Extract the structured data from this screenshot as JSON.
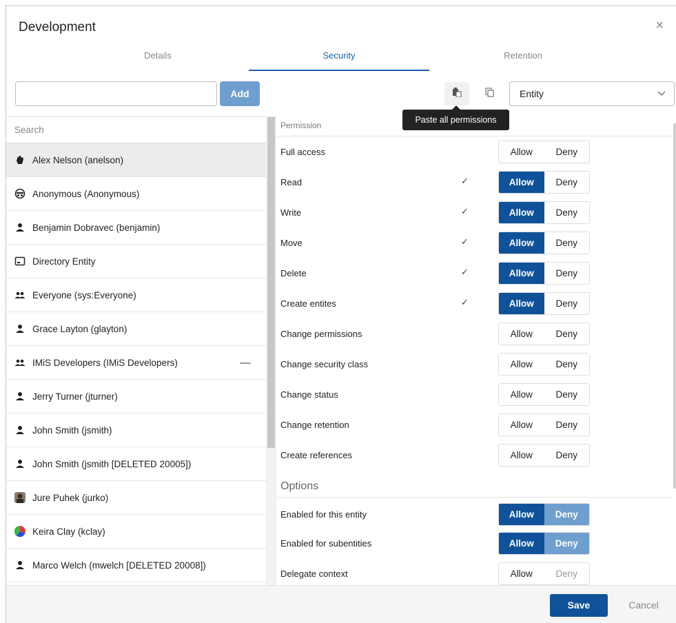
{
  "dialog": {
    "title": "Development",
    "close_icon": "×"
  },
  "tabs": [
    {
      "label": "Details",
      "active": false
    },
    {
      "label": "Security",
      "active": true
    },
    {
      "label": "Retention",
      "active": false
    }
  ],
  "toolbar": {
    "input_value": "",
    "add_label": "Add",
    "paste_tooltip": "Paste all permissions",
    "entity_select_value": "Entity"
  },
  "users": {
    "search_placeholder": "Search",
    "items": [
      {
        "label": "Alex Nelson (anelson)",
        "icon": "hand-icon",
        "selected": true
      },
      {
        "label": "Anonymous (Anonymous)",
        "icon": "anonymous-icon"
      },
      {
        "label": "Benjamin Dobravec (benjamin)",
        "icon": "person-icon"
      },
      {
        "label": "Directory Entity",
        "icon": "directory-icon"
      },
      {
        "label": "Everyone (sys:Everyone)",
        "icon": "group-icon"
      },
      {
        "label": "Grace Layton (glayton)",
        "icon": "person-icon"
      },
      {
        "label": "IMiS Developers (IMiS Developers)",
        "icon": "group-icon",
        "removable": true
      },
      {
        "label": "Jerry Turner (jturner)",
        "icon": "person-icon"
      },
      {
        "label": "John Smith (jsmith)",
        "icon": "person-icon"
      },
      {
        "label": "John Smith (jsmith [DELETED 20005])",
        "icon": "person-icon"
      },
      {
        "label": "Jure Puhek (jurko)",
        "icon": "photo-avatar-icon"
      },
      {
        "label": "Keira Clay (kclay)",
        "icon": "color-avatar-icon"
      },
      {
        "label": "Marco Welch (mwelch [DELETED 20008])",
        "icon": "person-icon"
      }
    ]
  },
  "permissions": {
    "header": "Permission",
    "allow_label": "Allow",
    "deny_label": "Deny",
    "rows": [
      {
        "label": "Full access",
        "checked": false,
        "state": "none"
      },
      {
        "label": "Read",
        "checked": true,
        "state": "allow"
      },
      {
        "label": "Write",
        "checked": true,
        "state": "allow"
      },
      {
        "label": "Move",
        "checked": true,
        "state": "allow"
      },
      {
        "label": "Delete",
        "checked": true,
        "state": "allow"
      },
      {
        "label": "Create entites",
        "checked": true,
        "state": "allow"
      },
      {
        "label": "Change permissions",
        "checked": false,
        "state": "none"
      },
      {
        "label": "Change security class",
        "checked": false,
        "state": "none"
      },
      {
        "label": "Change status",
        "checked": false,
        "state": "none"
      },
      {
        "label": "Change retention",
        "checked": false,
        "state": "none"
      },
      {
        "label": "Create references",
        "checked": false,
        "state": "none"
      }
    ],
    "check_mark": "✓"
  },
  "options": {
    "title": "Options",
    "rows": [
      {
        "label": "Enabled for this entity",
        "state": "allow-deny-light"
      },
      {
        "label": "Enabled for subentities",
        "state": "allow-deny-light"
      },
      {
        "label": "Delegate context",
        "state": "muted-deny"
      }
    ]
  },
  "footer": {
    "save_label": "Save",
    "cancel_label": "Cancel"
  }
}
